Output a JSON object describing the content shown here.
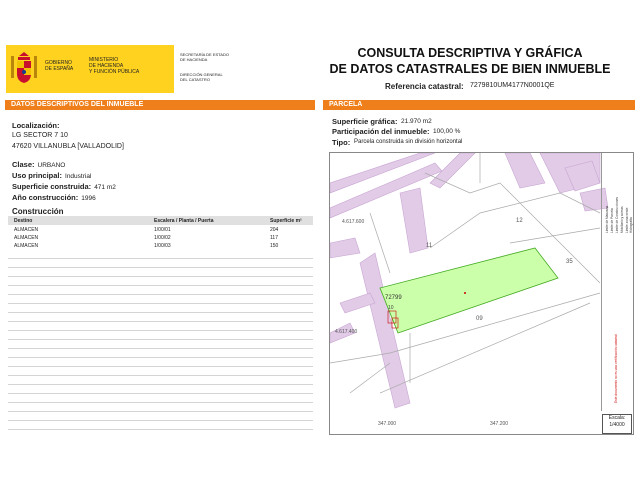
{
  "header": {
    "gobierno": "GOBIERNO DE ESPAÑA",
    "gobierno_l1": "GOBIERNO",
    "gobierno_l2": "DE ESPAÑA",
    "ministerio_l1": "MINISTERIO",
    "ministerio_l2": "DE HACIENDA",
    "ministerio_l3": "Y FUNCIÓN PÚBLICA",
    "secretaria_l1": "SECRETARÍA DE ESTADO",
    "secretaria_l2": "DE HACIENDA",
    "direccion_l1": "DIRECCIÓN GENERAL",
    "direccion_l2": "DEL CATASTRO",
    "title_l1": "CONSULTA DESCRIPTIVA Y GRÁFICA",
    "title_l2": "DE DATOS CATASTRALES DE BIEN INMUEBLE",
    "ref_label": "Referencia catastral:",
    "ref_value": "7279810UM4177N0001QE",
    "brand_yellow": "#ffd21f",
    "accent_orange": "#ee7f1a"
  },
  "left": {
    "section_title": "DATOS DESCRIPTIVOS DEL INMUEBLE",
    "localizacion_label": "Localización:",
    "localizacion_l1": "LG SECTOR 7 10",
    "localizacion_l2": "47620 VILLANUBLA [VALLADOLID]",
    "clase_label": "Clase:",
    "clase_value": "URBANO",
    "uso_label": "Uso principal:",
    "uso_value": "Industrial",
    "superficie_label": "Superficie construida:",
    "superficie_value": "471 m2",
    "anio_label": "Año construcción:",
    "anio_value": "1996",
    "construccion_title": "Construcción",
    "table": {
      "headers": [
        "Destino",
        "Escalera / Planta / Puerta",
        "Superficie m²"
      ],
      "rows": [
        [
          "ALMACEN",
          "1/00/01",
          "204"
        ],
        [
          "ALMACEN",
          "1/00/02",
          "117"
        ],
        [
          "ALMACEN",
          "1/00/03",
          "150"
        ]
      ]
    }
  },
  "right": {
    "section_title": "PARCELA",
    "sup_label": "Superficie gráfica:",
    "sup_value": "21.970 m2",
    "part_label": "Participación del inmueble:",
    "part_value": "100,00 %",
    "tipo_label": "Tipo:",
    "tipo_value": "Parcela construida sin división horizontal",
    "map": {
      "parcel_labels": [
        "11",
        "12",
        "35",
        "10",
        "09"
      ],
      "highlight_ref": "72799",
      "coords": [
        "4.617.400",
        "4.617.600",
        "347.000",
        "347.200"
      ],
      "parcel_color": "#ccffaa",
      "street_color": "#e1cbe7"
    },
    "legend": [
      "Límite de Manzana",
      "Límite de Parcela",
      "Límite de Construcciones",
      "Mobiliario y aceras",
      "Límite zona verde",
      "Hidrografía"
    ],
    "legend_note": "Este documento no es una certificación catastral",
    "scale_label": "Escala:",
    "scale_value": "1/4000"
  }
}
